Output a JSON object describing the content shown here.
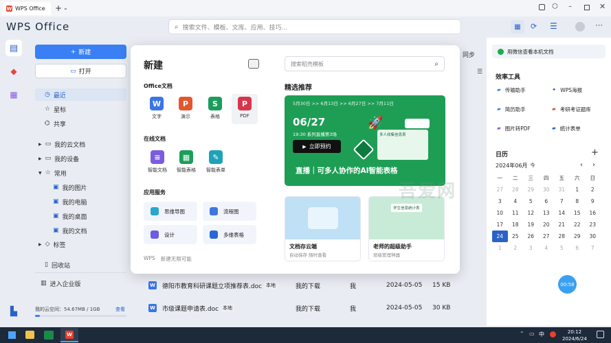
{
  "titlebar": {
    "app_tab": "WPS Office"
  },
  "brand": "WPS Office",
  "search": {
    "placeholder": "搜索文件、模板、文库、应用、技巧..."
  },
  "sidebar": {
    "new_label": "新建",
    "open_label": "打开",
    "items": [
      "最近",
      "星标",
      "共享",
      "我的云文档",
      "我的设备",
      "常用",
      "我的图片",
      "我的电脑",
      "我的桌面",
      "我的文档",
      "标签",
      "回收站",
      "进入企业版"
    ],
    "storage_label": "我的云空间：54.67MB / 1GB",
    "storage_view": "查看",
    "storage_fraction": 0.055
  },
  "panel": {
    "title": "新建",
    "office_section": "Office文档",
    "office_docs": [
      {
        "label": "文字",
        "icon": "W",
        "color": "#3a75e8"
      },
      {
        "label": "演示",
        "icon": "P",
        "color": "#e4572e"
      },
      {
        "label": "表格",
        "icon": "S",
        "color": "#1a9e5a"
      },
      {
        "label": "PDF",
        "icon": "P",
        "color": "#d9354a"
      }
    ],
    "online_section": "在线文档",
    "online_docs": [
      {
        "label": "智能文档",
        "color": "#7b5ce0"
      },
      {
        "label": "智能表格",
        "color": "#1a9e5a"
      },
      {
        "label": "智能表单",
        "color": "#1ea2b8"
      }
    ],
    "app_section": "应用服务",
    "services": [
      {
        "label": "思维导图",
        "color": "#2aa7c9"
      },
      {
        "label": "流程图",
        "color": "#3d77e0"
      },
      {
        "label": "设计",
        "color": "#6b5be6"
      },
      {
        "label": "多维表格",
        "color": "#2c66d6"
      }
    ],
    "footer_brand": "WPS",
    "footer_text": "新建无限可能",
    "template_search_placeholder": "搜索稻壳模板",
    "recommend_title": "精选推荐",
    "banner": {
      "dates": "5月30日 >> 6月13日 >> 6月27日 >> 7月11日",
      "date_big": "06/27",
      "time": "19:30 系列直播第3场",
      "button": "立即预约",
      "caption": "直播｜可多人协作的AI智能表格",
      "mini_title": "多人收集信息表"
    },
    "cards": [
      {
        "title": "文档存云端",
        "sub": "自动保存 随时查看"
      },
      {
        "title": "老师的超级助手",
        "sub": "班级管理神器"
      }
    ],
    "card2_badge": "学生信息统计表"
  },
  "list": {
    "peek": "同步",
    "rows": [
      {
        "name": "德阳市教育科研课题立项推荐表.doc",
        "tag": "本地",
        "location": "我的下载",
        "owner": "我",
        "date": "2024-05-05",
        "size": "15 KB"
      },
      {
        "name": "市级课题申请表.doc",
        "tag": "本地",
        "location": "我的下载",
        "owner": "我",
        "date": "2024-05-05",
        "size": "30 KB"
      }
    ]
  },
  "right": {
    "wechat_label": "用微信查看本机文档",
    "tools_title": "效率工具",
    "tools": [
      "传输助手",
      "WPS海报",
      "简历助手",
      "考研考证题库",
      "图片转PDF",
      "统计表单"
    ],
    "calendar_title": "日历",
    "month": "2024年06月",
    "month_dropdown": "今",
    "weekdays": [
      "一",
      "二",
      "三",
      "四",
      "五",
      "六",
      "日"
    ],
    "weeks": [
      [
        "27",
        "28",
        "29",
        "30",
        "31",
        "1",
        "2"
      ],
      [
        "3",
        "4",
        "5",
        "6",
        "7",
        "8",
        "9"
      ],
      [
        "10",
        "11",
        "12",
        "13",
        "14",
        "15",
        "16"
      ],
      [
        "17",
        "18",
        "19",
        "20",
        "21",
        "22",
        "23"
      ],
      [
        "24",
        "25",
        "26",
        "27",
        "28",
        "29",
        "30"
      ],
      [
        "1",
        "2",
        "3",
        "4",
        "5",
        "6",
        "7"
      ]
    ],
    "today": "24",
    "timer": "00:58"
  },
  "taskbar": {
    "time": "20:12",
    "date": "2024/6/24",
    "ime": "中"
  },
  "watermark": "吾爱网"
}
